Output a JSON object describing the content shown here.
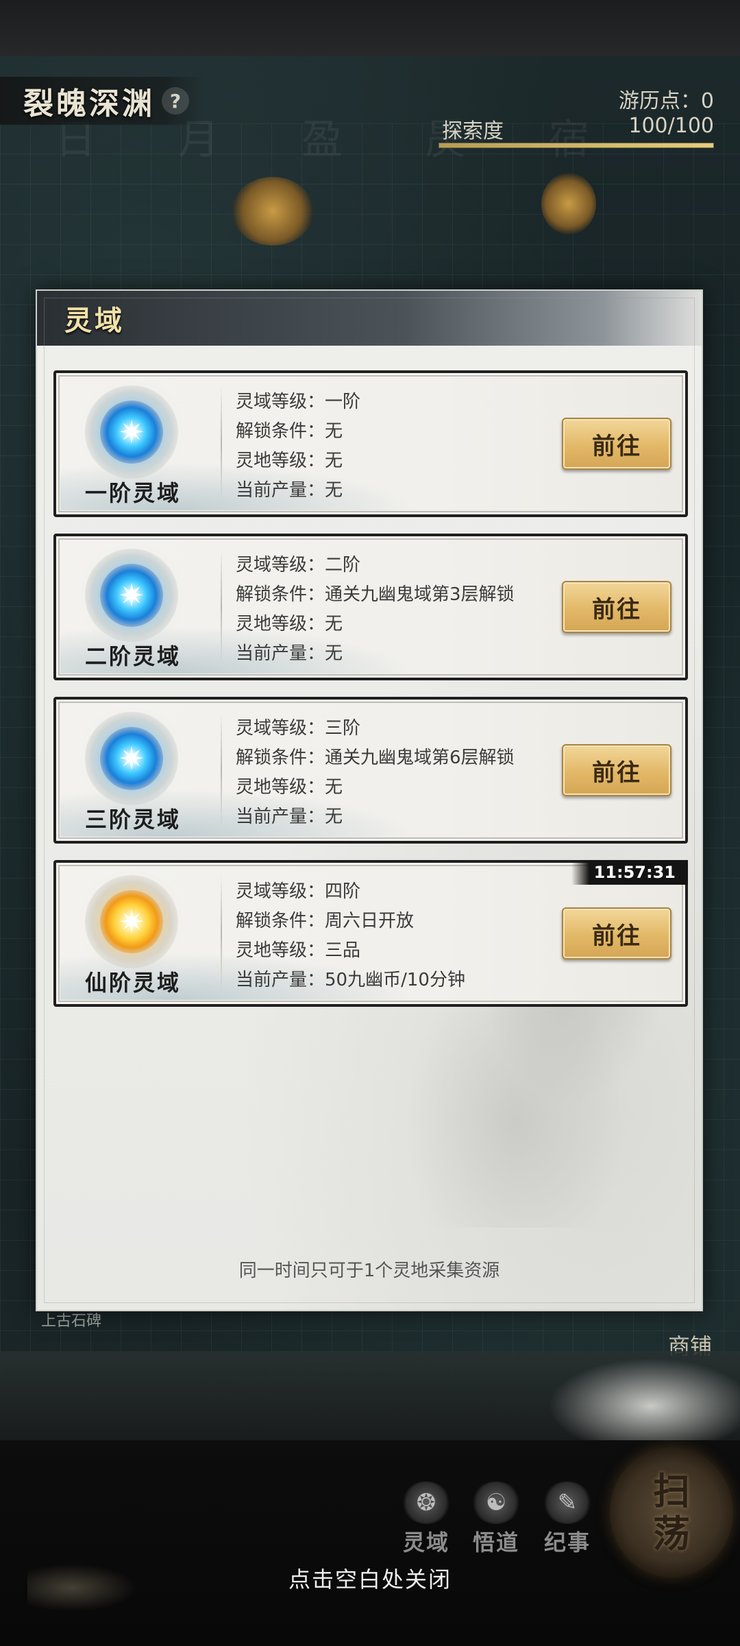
{
  "header": {
    "map_title": "裂魄深渊",
    "help_icon": "?",
    "travel_points": "游历点：0",
    "explore_label": "探索度",
    "explore_value": "100/100",
    "explore_progress": 1.0,
    "faint_chars": [
      "日",
      "月",
      "盈",
      "昃",
      "宿"
    ]
  },
  "scene": {
    "lower_label": "上古石碑",
    "shop_label": "商铺"
  },
  "panel": {
    "title": "灵域",
    "cards": [
      {
        "name": "一阶灵域",
        "orb": "blue",
        "rows": [
          {
            "key": "灵域等级：",
            "value": "一阶"
          },
          {
            "key": "解锁条件：",
            "value": "无"
          },
          {
            "key": "灵地等级：",
            "value": "无"
          },
          {
            "key": "当前产量：",
            "value": "无"
          }
        ],
        "button": "前往"
      },
      {
        "name": "二阶灵域",
        "orb": "blue",
        "rows": [
          {
            "key": "灵域等级：",
            "value": "二阶"
          },
          {
            "key": "解锁条件：",
            "value": "通关九幽鬼域第3层解锁"
          },
          {
            "key": "灵地等级：",
            "value": "无"
          },
          {
            "key": "当前产量：",
            "value": "无"
          }
        ],
        "button": "前往"
      },
      {
        "name": "三阶灵域",
        "orb": "blue",
        "rows": [
          {
            "key": "灵域等级：",
            "value": "三阶"
          },
          {
            "key": "解锁条件：",
            "value": "通关九幽鬼域第6层解锁"
          },
          {
            "key": "灵地等级：",
            "value": "无"
          },
          {
            "key": "当前产量：",
            "value": "无"
          }
        ],
        "button": "前往"
      },
      {
        "name": "仙阶灵域",
        "orb": "gold",
        "timer": "11:57:31",
        "rows": [
          {
            "key": "灵域等级：",
            "value": "四阶"
          },
          {
            "key": "解锁条件：",
            "value": "周六日开放"
          },
          {
            "key": "灵地等级：",
            "value": "三品"
          },
          {
            "key": "当前产量：",
            "value": "50九幽币/10分钟"
          }
        ],
        "button": "前往"
      }
    ],
    "footer_note": "同一时间只可于1个灵地采集资源"
  },
  "bottom_nav": {
    "items": [
      {
        "label": "灵域",
        "icon": "spirit-domain-icon"
      },
      {
        "label": "悟道",
        "icon": "enlightenment-icon"
      },
      {
        "label": "纪事",
        "icon": "chronicle-book-icon"
      }
    ],
    "sweep_label": "扫荡",
    "close_hint": "点击空白处关闭"
  },
  "colors": {
    "accent_gold": "#e2b867",
    "panel_bg": "#eeeeeb",
    "header_title": "#f2e2a8",
    "orb_blue": "#3cc6ff",
    "orb_gold": "#ffd23c"
  }
}
